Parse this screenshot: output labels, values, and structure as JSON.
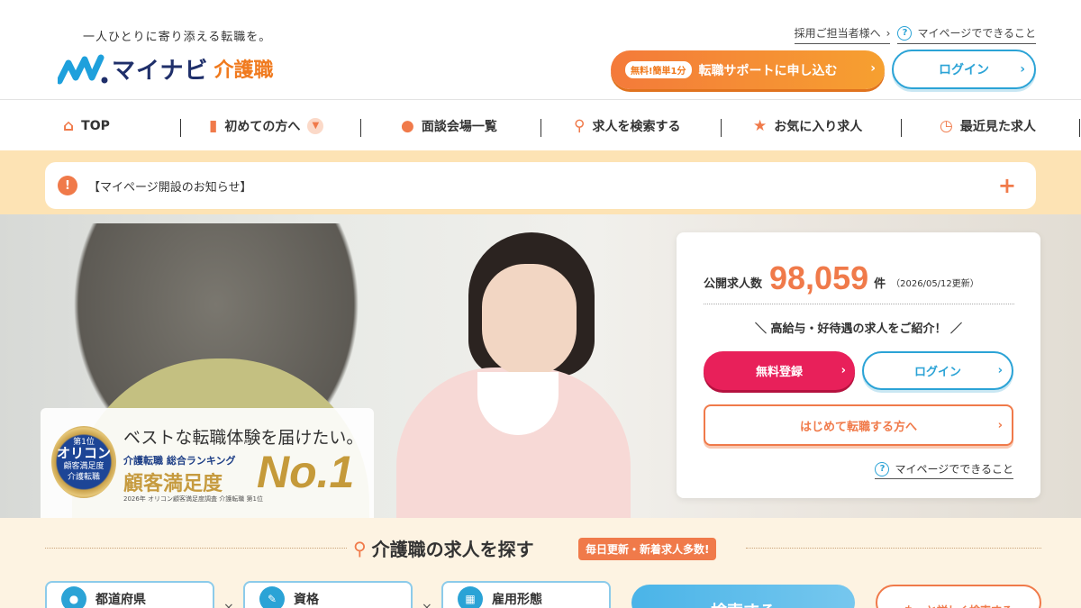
{
  "header": {
    "tagline": "一人ひとりに寄り添える転職を。",
    "logo_text": "マイナビ",
    "logo_sub": "介護職",
    "recruiter_link": "採用ご担当者様へ",
    "mypage_link": "マイページでできること",
    "support_badge": "無料!簡単1分",
    "support_label": "転職サポートに申し込む",
    "login_label": "ログイン"
  },
  "nav": {
    "items": [
      {
        "label": "TOP",
        "icon": "home-icon"
      },
      {
        "label": "初めての方へ",
        "icon": "bookmark-icon"
      },
      {
        "label": "面談会場一覧",
        "icon": "map-pin-icon"
      },
      {
        "label": "求人を検索する",
        "icon": "search-icon"
      },
      {
        "label": "お気に入り求人",
        "icon": "star-icon"
      },
      {
        "label": "最近見た求人",
        "icon": "clock-icon"
      }
    ]
  },
  "notice": {
    "text": "【マイページ開設のお知らせ】"
  },
  "hero": {
    "badge": {
      "headline": "ベストな転職体験を届けたい。",
      "medal_rank": "第1位",
      "medal_name": "オリコン",
      "medal_sub": "顧客満足度",
      "medal_cat": "介護転職",
      "subline": "介護転職 総合ランキング",
      "big": "顧客満足度",
      "no1": "No.1",
      "note": "2026年 オリコン顧客満足度調査 介護転職 第1位"
    },
    "panel": {
      "count_label": "公開求人数",
      "count_value": "98,059",
      "count_unit": "件",
      "count_date": "（2026/05/12更新）",
      "promo": "高給与・好待遇の求人をご紹介！",
      "free_register": "無料登録",
      "login": "ログイン",
      "first_time": "はじめて転職する方へ",
      "mypage_link": "マイページでできること"
    }
  },
  "search": {
    "title": "介護職の求人を探す",
    "badge": "毎日更新・新着求人多数!",
    "filters": [
      "都道府県",
      "資格",
      "雇用形態"
    ],
    "search_btn": "検索する",
    "detail_btn": "もっと詳しく検索する"
  },
  "colors": {
    "accent": "#f07a4a",
    "blue": "#2ba3d6",
    "pink": "#e8205a",
    "band": "#fde3b4"
  }
}
